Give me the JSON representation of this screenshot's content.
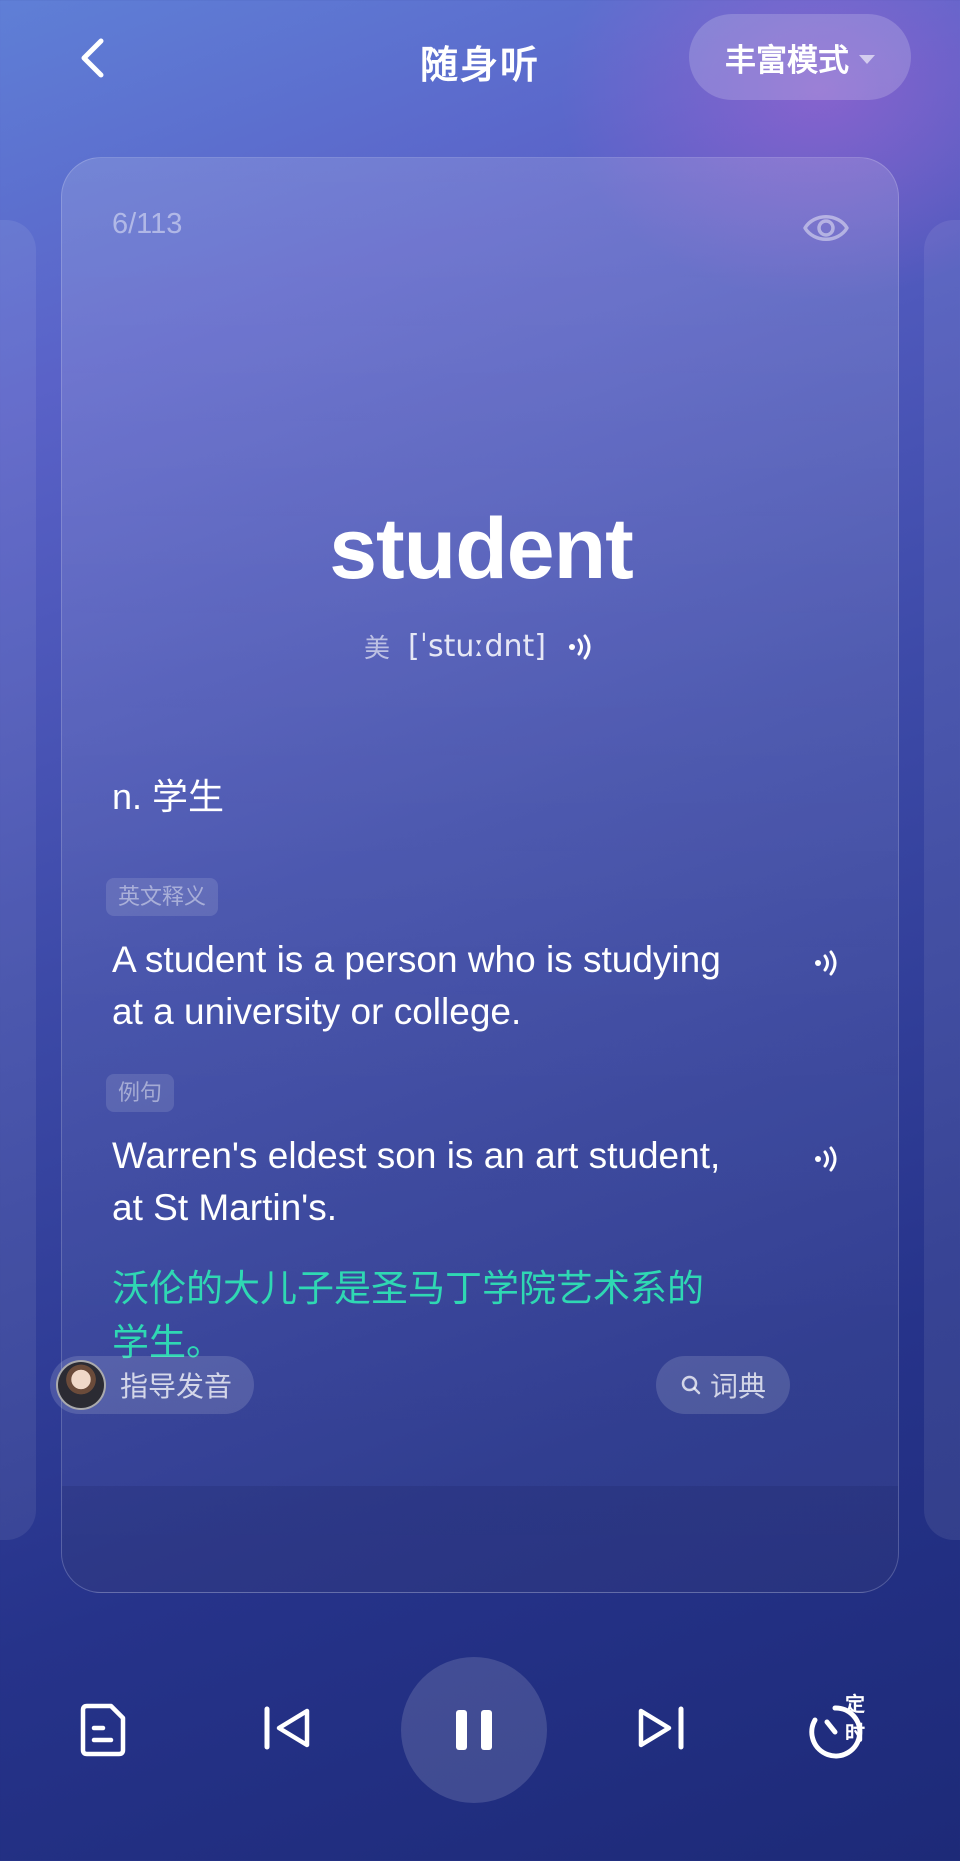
{
  "header": {
    "title": "随身听",
    "mode_label": "丰富模式"
  },
  "card": {
    "counter": "6/113",
    "word": "student",
    "pron_region": "美",
    "phonetic": "[ˈstuːdnt]",
    "definition": "n. 学生",
    "english_def_tag": "英文释义",
    "english_def": "A student is a person who is studying at a university or college.",
    "example_tag": "例句",
    "example_en": "Warren's eldest son is an art student, at St Martin's.",
    "example_cn": "沃伦的大儿子是圣马丁学院艺术系的学生。",
    "guide_label": "指导发音",
    "dict_label": "词典"
  },
  "player": {
    "timer_label": "定时"
  },
  "colors": {
    "translation": "#2fd8b3",
    "background_top": "#5f7fd6",
    "background_bottom": "#1d2a78"
  },
  "icons": [
    "back-arrow-icon",
    "caret-down-icon",
    "eye-icon",
    "speaker-icon",
    "search-icon",
    "document-icon",
    "previous-icon",
    "pause-icon",
    "next-icon",
    "timer-icon"
  ]
}
